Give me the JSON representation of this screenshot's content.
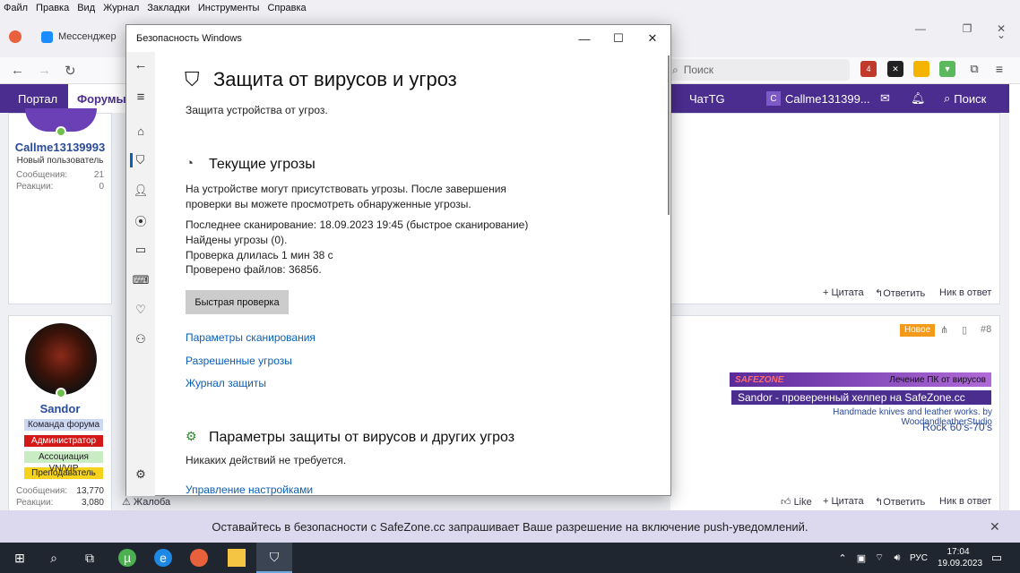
{
  "browser": {
    "menu": [
      "Файл",
      "Правка",
      "Вид",
      "Журнал",
      "Закладки",
      "Инструменты",
      "Справка"
    ],
    "tab_label": "Мессенджер",
    "search_placeholder": "Поиск",
    "ext_badge": "4"
  },
  "forum": {
    "nav": {
      "portal": "Портал",
      "forums": "Форумы",
      "chat": "ЧатTG",
      "user": "Callme131399...",
      "search": "Поиск",
      "user_initial": "C"
    },
    "post1": {
      "username": "Callme13139993",
      "role": "Новый пользователь",
      "stats": [
        {
          "label": "Сообщения:",
          "value": "21"
        },
        {
          "label": "Реакции:",
          "value": "0"
        }
      ],
      "actions": {
        "quote": "+ Цитата",
        "reply": "Ответить",
        "none": "Ник в ответ"
      }
    },
    "post2": {
      "username": "Sandor",
      "badges": [
        "Команда форума",
        "Администратор",
        "Ассоциация VN/VIP",
        "Преподаватель"
      ],
      "stats": [
        {
          "label": "Сообщения:",
          "value": "13,770"
        },
        {
          "label": "Реакции:",
          "value": "3,080"
        }
      ],
      "new_badge": "Новое",
      "post_no": "#8",
      "signature": {
        "banner_logo": "SAFEZONE",
        "banner_text": "Лечение ПК от вирусов",
        "line1": "Sandor - проверенный хелпер на SafeZone.cc",
        "line2": "Handmade knives and leather works. by WoodandleatherStudio",
        "line3": "Rock 60's-70's"
      },
      "actions": {
        "complaint": "Жалоба",
        "like": "Like",
        "quote": "+ Цитата",
        "reply": "Ответить",
        "none": "Ник в ответ"
      }
    }
  },
  "security_window": {
    "title": "Безопасность Windows",
    "heading": "Защита от вирусов и угроз",
    "subheading": "Защита устройства от угроз.",
    "current_threats": {
      "title": "Текущие угрозы",
      "desc1": "На устройстве могут присутствовать угрозы. После завершения",
      "desc2": "проверки вы можете просмотреть обнаруженные угрозы.",
      "last_scan": "Последнее сканирование: 18.09.2023 19:45 (быстрое сканирование)",
      "found": "Найдены угрозы (0).",
      "duration": "Проверка длилась 1 мин 38 с",
      "files": "Проверено файлов: 36856.",
      "quick_scan": "Быстрая проверка",
      "links": [
        "Параметры сканирования",
        "Разрешенные угрозы",
        "Журнал защиты"
      ]
    },
    "settings": {
      "title": "Параметры защиты от вирусов и других угроз",
      "desc": "Никаких действий не требуется.",
      "manage": "Управление настройками"
    }
  },
  "push_banner": {
    "text": "Оставайтесь в безопасности с SafeZone.cc запрашивает Ваше разрешение на включение push-уведомлений."
  },
  "taskbar": {
    "lang": "РУС",
    "time": "17:04",
    "date": "19.09.2023"
  },
  "colors": {
    "forum_purple": "#4b2d8f",
    "link_blue": "#0b5fb7",
    "taskbar": "#1f2630"
  }
}
